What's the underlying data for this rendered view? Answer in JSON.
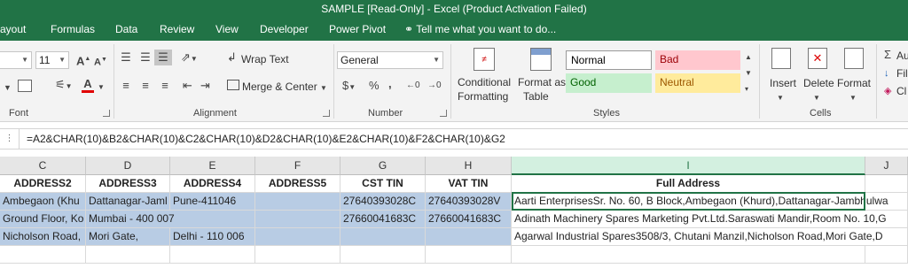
{
  "window": {
    "title": "SAMPLE  [Read-Only] - Excel (Product Activation Failed)"
  },
  "tabs": [
    "ayout",
    "Formulas",
    "Data",
    "Review",
    "View",
    "Developer",
    "Power Pivot"
  ],
  "tell_me": "Tell me what you want to do...",
  "ribbon": {
    "font": {
      "label": "Font",
      "size": "11",
      "grow": "A",
      "shrink": "A"
    },
    "alignment": {
      "label": "Alignment",
      "wrap_text": "Wrap Text",
      "merge_center": "Merge & Center"
    },
    "number": {
      "label": "Number",
      "format": "General",
      "currency": "$",
      "percent": "%",
      "comma": ","
    },
    "styles": {
      "label": "Styles",
      "conditional_formatting": [
        "Conditional",
        "Formatting"
      ],
      "format_as_table": [
        "Format as",
        "Table"
      ],
      "cell_styles": {
        "normal": "Normal",
        "bad": "Bad",
        "good": "Good",
        "neutral": "Neutral"
      }
    },
    "cells": {
      "label": "Cells",
      "insert": "Insert",
      "delete": "Delete",
      "format": "Format"
    },
    "editing": {
      "autosum": "Au",
      "fill": "Fil",
      "clear": "Cl"
    }
  },
  "formula_bar": {
    "formula": "=A2&CHAR(10)&B2&CHAR(10)&C2&CHAR(10)&D2&CHAR(10)&E2&CHAR(10)&F2&CHAR(10)&G2"
  },
  "sheet": {
    "columns": [
      "C",
      "D",
      "E",
      "F",
      "G",
      "H",
      "I",
      "J"
    ],
    "selected_column": "I",
    "rows": [
      {
        "cells": [
          "ADDRESS2",
          "ADDRESS3",
          "ADDRESS4",
          "ADDRESS5",
          "CST TIN",
          "VAT TIN",
          "Full Address",
          ""
        ]
      },
      {
        "cells": [
          "Ambegaon (Khu",
          "Dattanagar-Jaml",
          "Pune-411046",
          "",
          "27640393028C",
          "27640393028V",
          "Aarti EnterprisesSr. No. 60, B Block,Ambegaon (Khurd),Dattanagar-Jambhulwa",
          ""
        ]
      },
      {
        "cells": [
          "Ground Floor, Ko",
          "Mumbai - 400 007",
          "",
          "",
          "27660041683C",
          "27660041683C",
          "Adinath Machinery Spares Marketing Pvt.Ltd.Saraswati Mandir,Room No. 10,G",
          ""
        ]
      },
      {
        "cells": [
          "Nicholson Road,",
          "Mori Gate,",
          "Delhi - 110 006",
          "",
          "",
          "",
          "Agarwal Industrial Spares3508/3, Chutani Manzil,Nicholson Road,Mori Gate,D",
          ""
        ]
      }
    ]
  },
  "colors": {
    "excel_green": "#217346",
    "selection_blue": "#b8cce4",
    "bad_bg": "#ffc7ce",
    "good_bg": "#c6efce",
    "neutral_bg": "#ffeb9c"
  }
}
